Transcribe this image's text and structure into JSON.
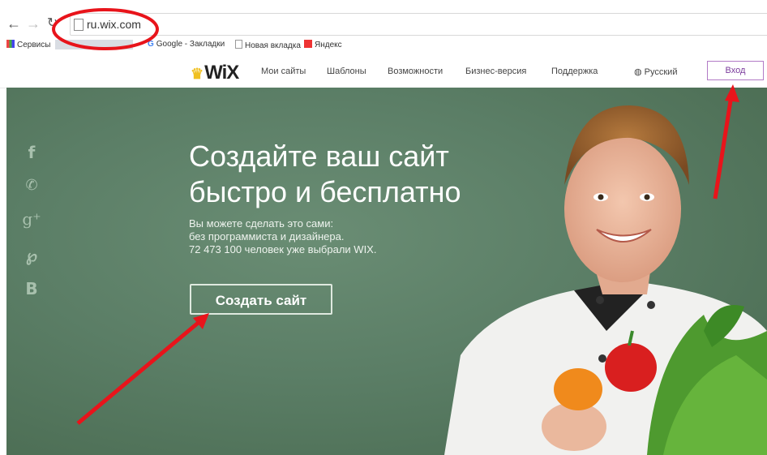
{
  "browser": {
    "url": "ru.wix.com",
    "bookmarks": [
      "Сервисы",
      "Google - Закладки",
      "Новая вкладка",
      "Яндекс"
    ]
  },
  "navbar": {
    "logo": "WiX",
    "items": [
      "Мои сайты",
      "Шаблоны",
      "Возможности",
      "Бизнес-версия",
      "Поддержка"
    ],
    "language": "Русский",
    "login_label": "Вход"
  },
  "hero": {
    "headline_line1": "Создайте ваш сайт",
    "headline_line2": "быстро и бесплатно",
    "sub_line1": "Вы можете сделать это сами:",
    "sub_line2": "без программиста и дизайнера.",
    "sub_line3": "72 473 100 человек уже выбрали WIX.",
    "cta_label": "Создать сайт"
  },
  "social_icons": [
    "facebook-icon",
    "twitter-icon",
    "google-plus-icon",
    "pinterest-icon",
    "vk-icon"
  ],
  "colors": {
    "hero_green": "#5b7e66",
    "annotation_red": "#e8141b",
    "login_border": "#b27ac6"
  }
}
